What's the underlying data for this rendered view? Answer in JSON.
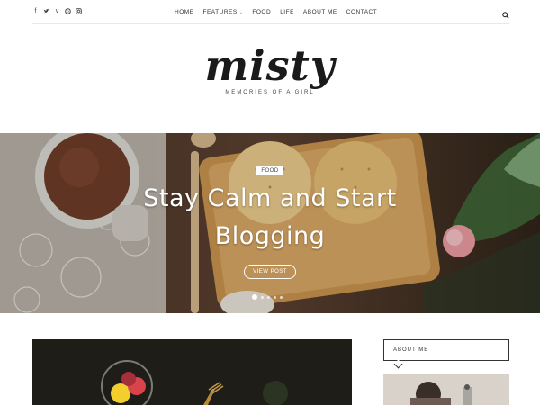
{
  "header": {
    "social_icons": [
      "facebook-icon",
      "twitter-icon",
      "vimeo-icon",
      "pinterest-icon",
      "instagram-icon"
    ],
    "nav": [
      {
        "label": "HOME"
      },
      {
        "label": "FEATURES",
        "has_dropdown": true
      },
      {
        "label": "FOOD"
      },
      {
        "label": "LIFE"
      },
      {
        "label": "ABOUT ME"
      },
      {
        "label": "CONTACT"
      }
    ],
    "search_icon": "search-icon"
  },
  "logo": {
    "title": "misty",
    "subtitle": "MEMORIES OF A GIRL"
  },
  "hero": {
    "category": "FOOD",
    "title": "Stay Calm and Start Blogging",
    "button_label": "VIEW POST",
    "slide_count": 5,
    "active_slide": 1
  },
  "sidebar": {
    "about_title": "ABOUT ME"
  },
  "colors": {
    "text": "#222222",
    "divider": "#e9e9e9",
    "hero_overlay_text": "#ffffff"
  }
}
